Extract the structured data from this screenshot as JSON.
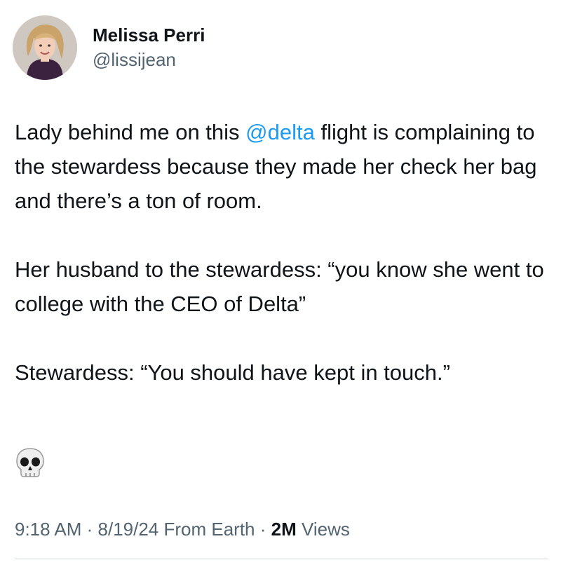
{
  "author": {
    "display_name": "Melissa Perri",
    "handle": "@lissijean",
    "avatar_icon": "profile-photo"
  },
  "tweet": {
    "p1_before": "Lady behind me on this ",
    "p1_mention": "@delta",
    "p1_after": " flight is complaining to the stewardess because they made her check her bag and there’s a ton of room.",
    "p2": "Her husband to the stewardess: “you know she went to college with the CEO of Delta”",
    "p3": "Stewardess: “You should have kept in touch.”",
    "emoji_icon": "skull-icon"
  },
  "meta": {
    "time": "9:18 AM",
    "sep1": " · ",
    "date": "8/19/24",
    "source": " From Earth",
    "sep2": " · ",
    "views_count": "2M",
    "views_label": " Views"
  },
  "colors": {
    "text": "#0f1419",
    "secondary": "#536471",
    "link": "#1d9bf0",
    "divider": "#cfd9de"
  }
}
